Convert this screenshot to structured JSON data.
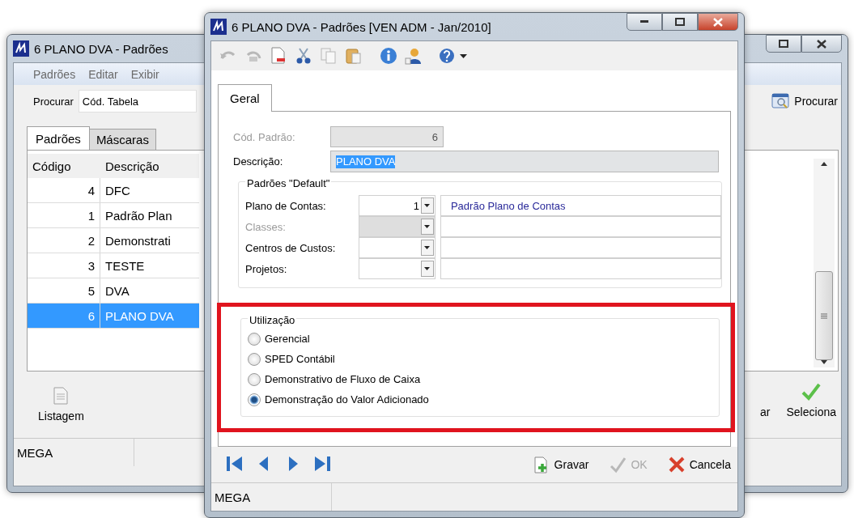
{
  "back_window": {
    "title": "6 PLANO DVA - Padrões",
    "menu": [
      "Padrões",
      "Editar",
      "Exibir"
    ],
    "search": {
      "label": "Procurar",
      "value": "Cód. Tabela",
      "button": "Procurar"
    },
    "tabs": [
      {
        "label": "Padrões",
        "selected": true
      },
      {
        "label": "Máscaras",
        "selected": false
      }
    ],
    "table": {
      "columns": [
        "Código",
        "Descrição"
      ],
      "rows": [
        {
          "code": "4",
          "description": "DFC",
          "selected": false
        },
        {
          "code": "1",
          "description": "Padrão Plan",
          "selected": false
        },
        {
          "code": "2",
          "description": "Demonstrati",
          "selected": false
        },
        {
          "code": "3",
          "description": "TESTE",
          "selected": false
        },
        {
          "code": "5",
          "description": "DVA",
          "selected": false
        },
        {
          "code": "6",
          "description": "PLANO DVA",
          "selected": true
        }
      ]
    },
    "actions_left": [
      {
        "label": "Listagem"
      }
    ],
    "actions_right": [
      {
        "label": "ar",
        "kind": "text"
      },
      {
        "label": "Seleciona",
        "kind": "check"
      }
    ],
    "status_bar": [
      "MEGA"
    ]
  },
  "dialog": {
    "title": "6 PLANO DVA -  Padrões [VEN ADM - Jan/2010]",
    "tabs": [
      {
        "label": "Geral",
        "selected": true
      }
    ],
    "fields": [
      {
        "label": "Cód. Padrão:",
        "value": "6",
        "disabled": true,
        "kind": "number"
      },
      {
        "label": "Descrição:",
        "value": "PLANO DVA",
        "disabled": false,
        "kind": "text"
      }
    ],
    "defaults_group": {
      "title": "Padrões \"Default\"",
      "rows": [
        {
          "label": "Plano de Contas:",
          "code": "1",
          "name": "Padrão Plano de Contas",
          "disabled": false
        },
        {
          "label": "Classes:",
          "disabled": true
        },
        {
          "label": "Centros de Custos:",
          "disabled": false
        },
        {
          "label": "Projetos:",
          "disabled": false
        }
      ]
    },
    "usage_group": {
      "title": "Utilização",
      "highlighted": true,
      "options": [
        {
          "label": "Gerencial",
          "selected": false
        },
        {
          "label": "SPED Contábil",
          "selected": false
        },
        {
          "label": "Demonstrativo de Fluxo de Caixa",
          "selected": false
        },
        {
          "label": "Demonstração do Valor Adicionado",
          "selected": true
        }
      ]
    },
    "buttons": [
      {
        "label": "Gravar",
        "kind": "save",
        "disabled": false
      },
      {
        "label": "OK",
        "kind": "ok",
        "disabled": true
      },
      {
        "label": "Cancela",
        "kind": "cancel",
        "disabled": false
      }
    ],
    "status_bar": [
      "MEGA"
    ]
  }
}
